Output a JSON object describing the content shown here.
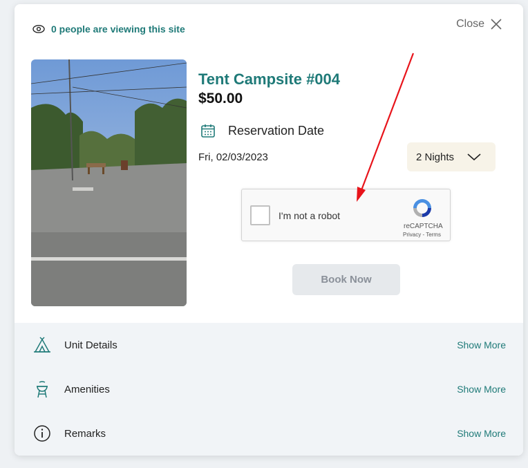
{
  "viewers": {
    "text": "0 people are viewing this site"
  },
  "close": {
    "label": "Close"
  },
  "site": {
    "title": "Tent Campsite #004",
    "price": "$50.00",
    "reservation_label": "Reservation Date",
    "date": "Fri, 02/03/2023",
    "nights": "2 Nights"
  },
  "captcha": {
    "label": "I'm not a robot",
    "brand": "reCAPTCHA",
    "links": "Privacy - Terms"
  },
  "book": {
    "label": "Book Now"
  },
  "details": {
    "rows": [
      {
        "label": "Unit Details",
        "action": "Show More",
        "icon": "tent-icon"
      },
      {
        "label": "Amenities",
        "action": "Show More",
        "icon": "grill-icon"
      },
      {
        "label": "Remarks",
        "action": "Show More",
        "icon": "info-icon"
      }
    ]
  },
  "colors": {
    "accent": "#1f7a78",
    "nights_bg": "#f7f3e8",
    "arrow": "#e8141b"
  }
}
